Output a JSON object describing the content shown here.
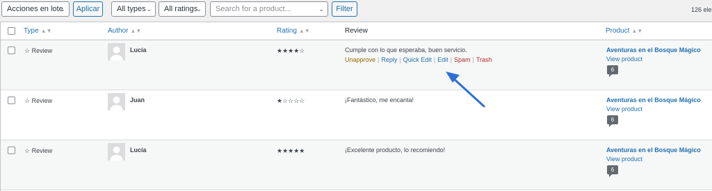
{
  "toolbar": {
    "bulk_actions": "Acciones en lote",
    "apply": "Aplicar",
    "types_filter": "All types",
    "ratings_filter": "All ratings",
    "search_placeholder": "Search for a product...",
    "filter": "Filter",
    "items_count": "126 ele"
  },
  "columns": {
    "type": "Type",
    "author": "Author",
    "rating": "Rating",
    "review": "Review",
    "product": "Product"
  },
  "rows": [
    {
      "type": "☆ Review",
      "author": "Lucía",
      "rating": "★★★★☆",
      "review": "Cumple con lo que esperaba, buen servicio.",
      "actions": [
        "Unapprove",
        "Reply",
        "Quick Edit",
        "Edit",
        "Spam",
        "Trash"
      ],
      "product": "Aventuras en el Bosque Mágico",
      "view_product": "View product",
      "count": "6"
    },
    {
      "type": "☆ Review",
      "author": "Juan",
      "rating": "★☆☆☆☆",
      "review": "¡Fantástico, me encanta!",
      "product": "Aventuras en el Bosque Mágico",
      "view_product": "View product",
      "count": "6"
    },
    {
      "type": "☆ Review",
      "author": "Lucía",
      "rating": "★★★★★",
      "review": "¡Excelente producto, lo recomiendo!",
      "product": "Aventuras en el Bosque Mágico",
      "view_product": "View product",
      "count": "6"
    }
  ],
  "colors": {
    "link": "#2271b1",
    "unapprove": "#996800",
    "delete": "#b32d2e",
    "annotation_arrow": "#2b6fd6"
  }
}
